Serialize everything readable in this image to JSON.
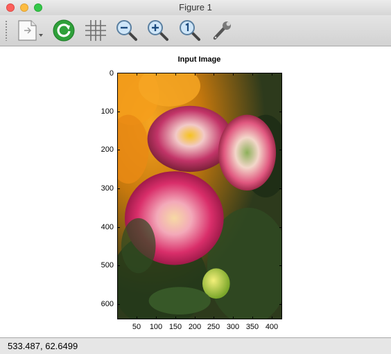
{
  "window": {
    "title": "Figure 1"
  },
  "toolbar": {
    "buttons": [
      {
        "name": "new-figure-icon"
      },
      {
        "name": "refresh-icon"
      },
      {
        "name": "grid-icon"
      },
      {
        "name": "zoom-out-icon"
      },
      {
        "name": "zoom-in-icon"
      },
      {
        "name": "zoom-reset-icon"
      },
      {
        "name": "settings-wrench-icon"
      }
    ]
  },
  "figure": {
    "title": "Input Image",
    "y_ticks": [
      "0",
      "100",
      "200",
      "300",
      "400",
      "500",
      "600"
    ],
    "x_ticks": [
      "50",
      "100",
      "150",
      "200",
      "250",
      "300",
      "350",
      "400"
    ],
    "image_description": "Photo of pink and white dahlia flowers with orange flowers in the background"
  },
  "status": {
    "coordinates": "533.487,  62.6499"
  },
  "colors": {
    "close": "#fc605c",
    "minimize": "#fdbc40",
    "maximize": "#34c84a",
    "refresh_green": "#2fa03a"
  }
}
